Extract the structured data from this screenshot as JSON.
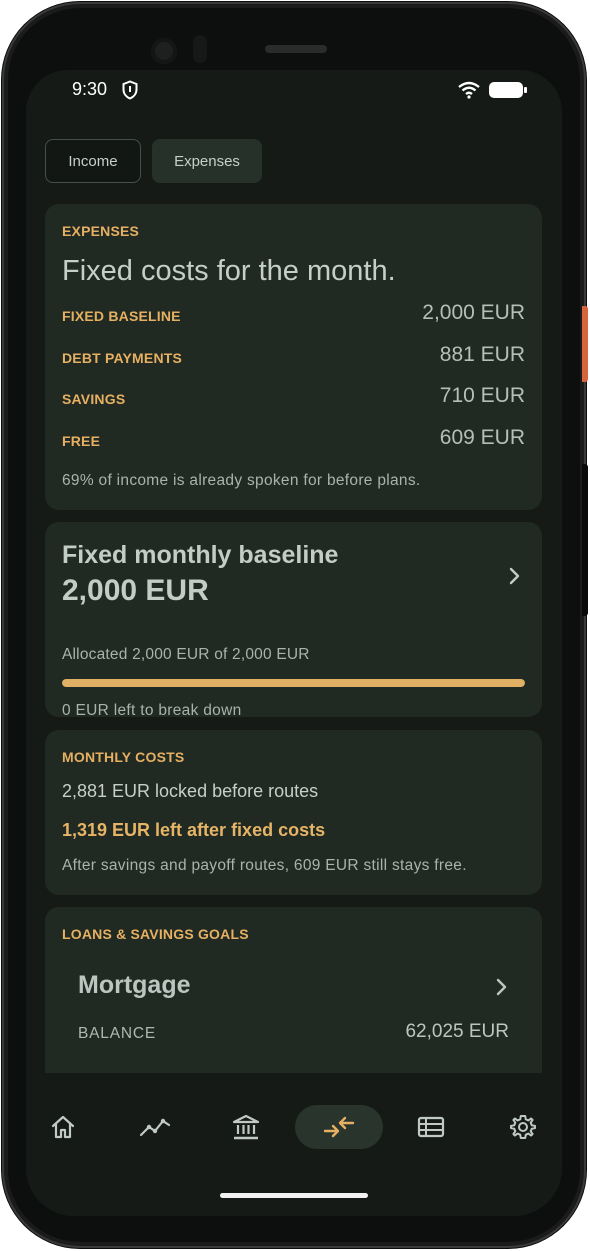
{
  "status_bar": {
    "time": "9:30"
  },
  "tabs": [
    {
      "label": "Income",
      "selected": false
    },
    {
      "label": "Expenses",
      "selected": true
    }
  ],
  "expenses_card": {
    "label": "EXPENSES",
    "headline": "Fixed costs for the month.",
    "rows": [
      {
        "label": "FIXED BASELINE",
        "value": "2,000 EUR"
      },
      {
        "label": "DEBT PAYMENTS",
        "value": "881 EUR"
      },
      {
        "label": "SAVINGS",
        "value": "710 EUR"
      },
      {
        "label": "FREE",
        "value": "609 EUR"
      }
    ],
    "footnote": "69% of income is already spoken for before plans."
  },
  "baseline_card": {
    "title": "Fixed monthly baseline",
    "amount": "2,000 EUR",
    "allocated": "Allocated 2,000 EUR of 2,000 EUR",
    "progress_fraction": 1.0,
    "left_text": "0 EUR left to break down"
  },
  "monthly_costs_card": {
    "label": "MONTHLY COSTS",
    "locked": "2,881 EUR locked before routes",
    "left_after": "1,319 EUR left after fixed costs",
    "note": "After savings and payoff routes, 609 EUR still stays free."
  },
  "goals_card": {
    "label": "LOANS & SAVINGS GOALS",
    "item_title": "Mortgage",
    "balance_label": "BALANCE",
    "balance_value": "62,025 EUR"
  },
  "nav": {
    "items": [
      {
        "icon": "home-icon",
        "active": false
      },
      {
        "icon": "trend-icon",
        "active": false
      },
      {
        "icon": "bank-icon",
        "active": false
      },
      {
        "icon": "transfer-arrows-icon",
        "active": true
      },
      {
        "icon": "list-icon",
        "active": false
      },
      {
        "icon": "gear-icon",
        "active": false
      }
    ]
  },
  "colors": {
    "accent": "#e5b062",
    "background": "#151a17",
    "card": "#212923"
  }
}
